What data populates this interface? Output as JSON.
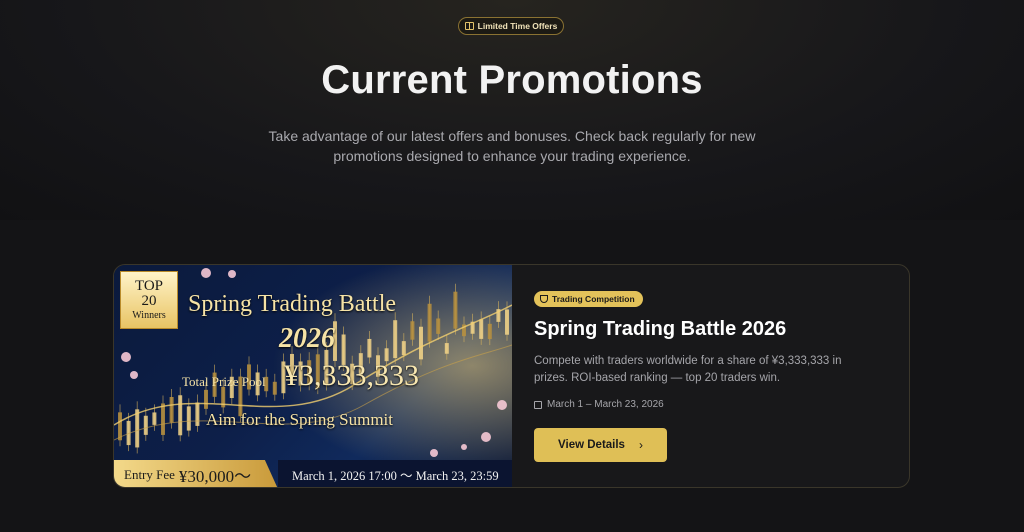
{
  "hero": {
    "badge_label": "Limited Time Offers",
    "badge_icon": "gift-icon",
    "title": "Current Promotions",
    "subtitle": "Take advantage of our latest offers and bonuses. Check back regularly for new promotions designed to enhance your trading experience."
  },
  "promotion": {
    "banner": {
      "badge_top": "TOP",
      "badge_number": "20",
      "badge_winners": "Winners",
      "title": "Spring Trading Battle",
      "year": "2026",
      "prize_label": "Total Prize Pool",
      "prize_value": "¥3,333,333",
      "slogan": "Aim for the Spring Summit",
      "entry_fee_label": "Entry Fee",
      "entry_fee_value": "¥30,000～",
      "date_range": "March 1, 2026 17:00 ～ March 23, 23:59"
    },
    "tag_label": "Trading Competition",
    "tag_icon": "trophy-icon",
    "title": "Spring Trading Battle 2026",
    "description": "Compete with traders worldwide for a share of ¥3,333,333 in prizes. ROI-based ranking — top 20 traders win.",
    "date_icon": "calendar-icon",
    "date_text": "March 1 – March 23, 2026",
    "button_label": "View Details",
    "button_icon": "chevron-right-icon"
  },
  "colors": {
    "background": "#141416",
    "accent_gold": "#dfbf56",
    "banner_navy": "#0d1f49"
  }
}
